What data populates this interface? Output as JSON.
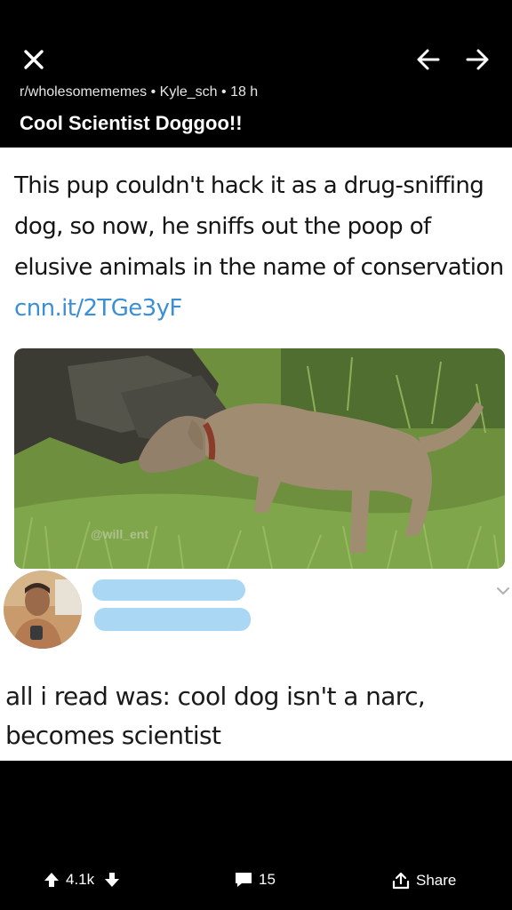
{
  "post": {
    "meta": "r/wholesomememes • Kyle_sch • 18 h",
    "title": "Cool Scientist Doggoo!!"
  },
  "tweet": {
    "text": "This pup couldn't hack it as a drug-sniffing dog, so now, he sniffs out the poop of elusive animals in the name of conservation",
    "link": "cnn.it/2TGe3yF",
    "watermark": "@will_ent"
  },
  "reply": {
    "text": "all i read was: cool dog isn't a narc, becomes scientist"
  },
  "actions": {
    "upvotes": "4.1k",
    "comments": "15",
    "share": "Share"
  },
  "icons": [
    "close-icon",
    "arrow-left-icon",
    "arrow-right-icon",
    "chevron-down-icon",
    "upvote-icon",
    "downvote-icon",
    "comment-icon",
    "share-icon"
  ]
}
